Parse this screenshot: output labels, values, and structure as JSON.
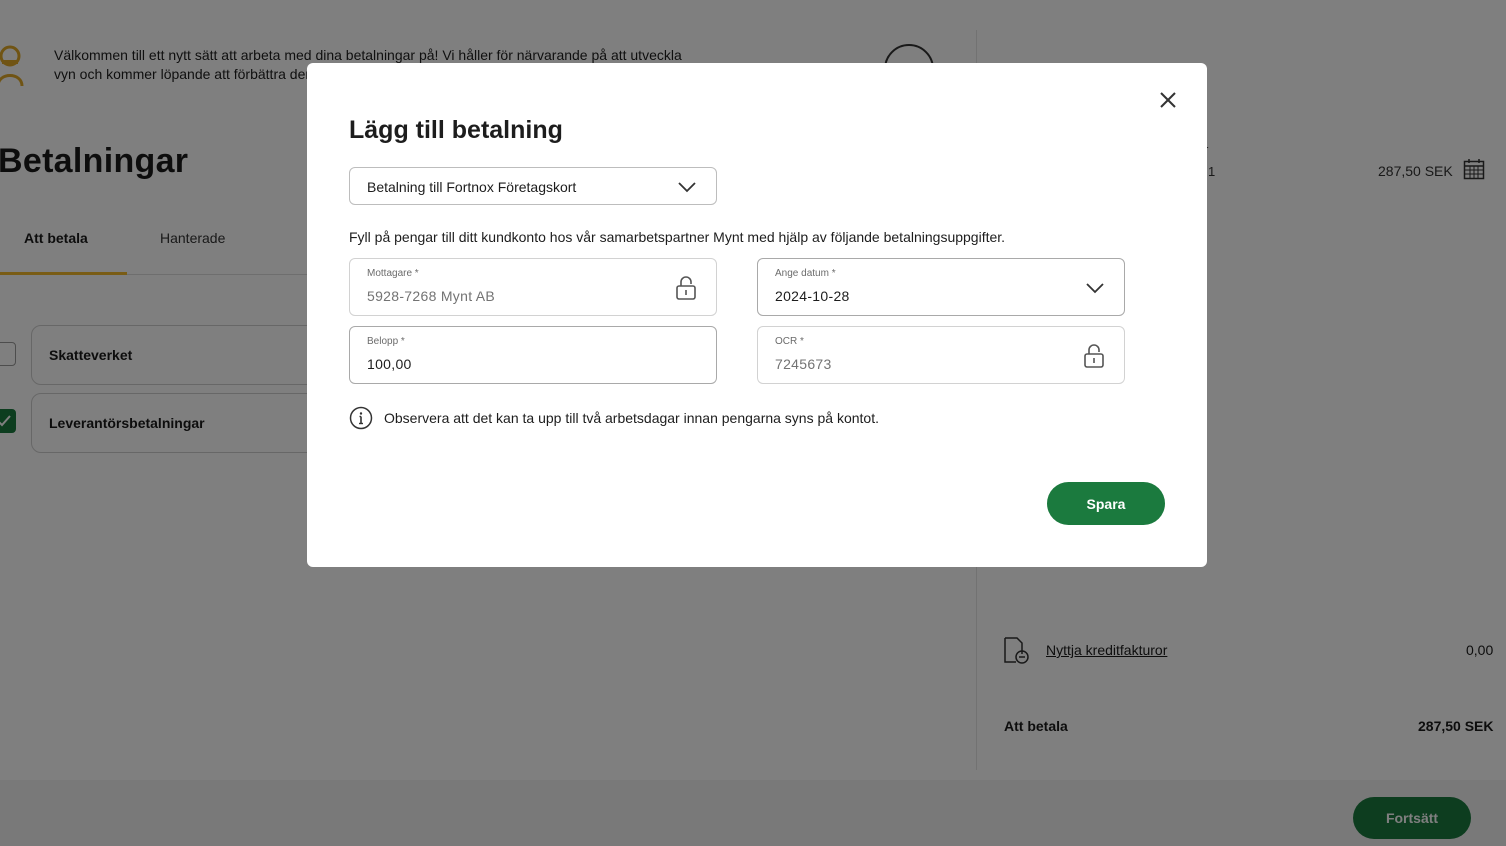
{
  "background": {
    "welcome_text": "Välkommen till ett nytt sätt att arbeta med dina betalningar på! Vi håller för närvarande på att utveckla vyn och kommer löpande att förbättra den – vi är glada att ha dig med på denna resa!",
    "page_title": "Betalningar",
    "tabs": [
      {
        "label": "Att betala"
      },
      {
        "label": "Hanterade"
      }
    ],
    "cards": [
      {
        "label": "Skatteverket"
      },
      {
        "label": "Leverantörsbetalningar"
      }
    ],
    "summary": {
      "peek_line_1": "r",
      "peek_line_2": "1",
      "amount_top": "287,50 SEK",
      "credit_link": "Nyttja kreditfakturor",
      "credit_value": "0,00",
      "pay_label": "Att betala",
      "pay_value": "287,50 SEK"
    },
    "continue_button": "Fortsätt"
  },
  "modal": {
    "title": "Lägg till betalning",
    "payment_type": "Betalning till Fortnox Företagskort",
    "description": "Fyll på pengar till ditt kundkonto hos vår samarbetspartner Mynt med hjälp av följande betalningsuppgifter.",
    "fields": {
      "recipient": {
        "label": "Mottagare *",
        "value": "5928-7268 Mynt AB"
      },
      "date": {
        "label": "Ange datum *",
        "value": "2024-10-28"
      },
      "amount": {
        "label": "Belopp *",
        "value": "100,00"
      },
      "ocr": {
        "label": "OCR *",
        "value": "7245673"
      }
    },
    "info": "Observera att det kan ta upp till två arbetsdagar innan pengarna syns på kontot.",
    "save_button": "Spara"
  },
  "colors": {
    "primary_green": "#1b7a3e",
    "accent_yellow": "#f3b92b",
    "overlay": "rgba(0,0,0,0.5)"
  }
}
